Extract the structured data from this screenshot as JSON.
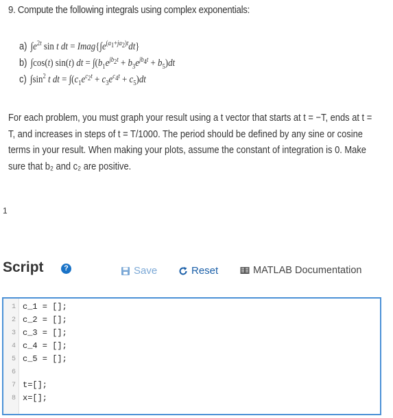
{
  "problem": {
    "title": "9. Compute the following integrals using complex exponentials:",
    "items": [
      {
        "label": "a)"
      },
      {
        "label": "b)"
      },
      {
        "label": "c)"
      }
    ],
    "paragraph": [
      "For each problem, you must graph your result using a t vector that starts at t = −T, ends at t =",
      "T, and increases in steps of t = T/1000.  The period should be defined by any sine or cosine",
      "terms in your result.  When making your plots, assume the constant of integration is 0.  Make",
      "sure that b₂ and c₂ are positive."
    ]
  },
  "page_number": "1",
  "script": {
    "title": "Script",
    "help_icon": "?",
    "save_label": "Save",
    "reset_label": "Reset",
    "doc_label": "MATLAB Documentation"
  },
  "editor": {
    "lines": [
      {
        "num": "1",
        "code": "c_1 = [];"
      },
      {
        "num": "2",
        "code": "c_2 = [];"
      },
      {
        "num": "3",
        "code": "c_3 = [];"
      },
      {
        "num": "4",
        "code": "c_4 = [];"
      },
      {
        "num": "5",
        "code": "c_5 = [];"
      },
      {
        "num": "6",
        "code": ""
      },
      {
        "num": "7",
        "code": "t=[];"
      },
      {
        "num": "8",
        "code": "x=[];"
      }
    ]
  }
}
